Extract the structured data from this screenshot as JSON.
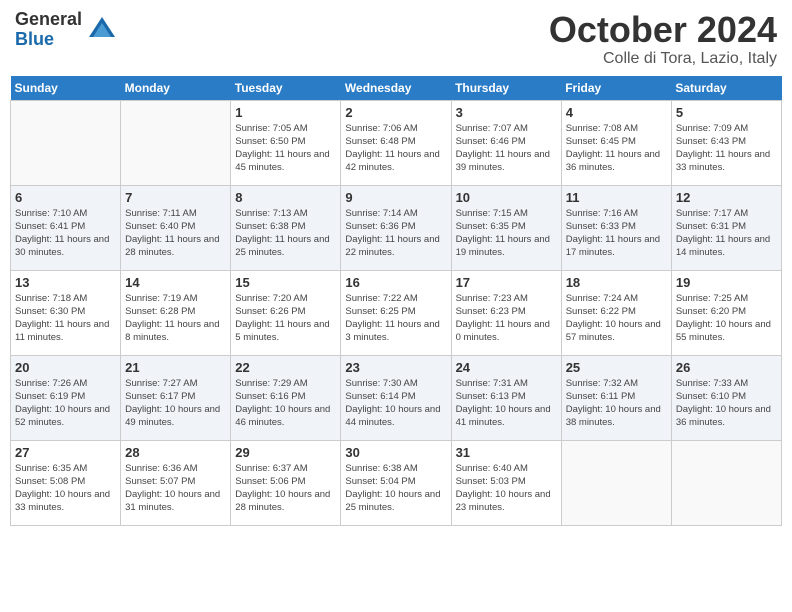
{
  "logo": {
    "general": "General",
    "blue": "Blue"
  },
  "title": "October 2024",
  "location": "Colle di Tora, Lazio, Italy",
  "days_header": [
    "Sunday",
    "Monday",
    "Tuesday",
    "Wednesday",
    "Thursday",
    "Friday",
    "Saturday"
  ],
  "weeks": [
    [
      {
        "num": "",
        "sunrise": "",
        "sunset": "",
        "daylight": ""
      },
      {
        "num": "",
        "sunrise": "",
        "sunset": "",
        "daylight": ""
      },
      {
        "num": "1",
        "sunrise": "Sunrise: 7:05 AM",
        "sunset": "Sunset: 6:50 PM",
        "daylight": "Daylight: 11 hours and 45 minutes."
      },
      {
        "num": "2",
        "sunrise": "Sunrise: 7:06 AM",
        "sunset": "Sunset: 6:48 PM",
        "daylight": "Daylight: 11 hours and 42 minutes."
      },
      {
        "num": "3",
        "sunrise": "Sunrise: 7:07 AM",
        "sunset": "Sunset: 6:46 PM",
        "daylight": "Daylight: 11 hours and 39 minutes."
      },
      {
        "num": "4",
        "sunrise": "Sunrise: 7:08 AM",
        "sunset": "Sunset: 6:45 PM",
        "daylight": "Daylight: 11 hours and 36 minutes."
      },
      {
        "num": "5",
        "sunrise": "Sunrise: 7:09 AM",
        "sunset": "Sunset: 6:43 PM",
        "daylight": "Daylight: 11 hours and 33 minutes."
      }
    ],
    [
      {
        "num": "6",
        "sunrise": "Sunrise: 7:10 AM",
        "sunset": "Sunset: 6:41 PM",
        "daylight": "Daylight: 11 hours and 30 minutes."
      },
      {
        "num": "7",
        "sunrise": "Sunrise: 7:11 AM",
        "sunset": "Sunset: 6:40 PM",
        "daylight": "Daylight: 11 hours and 28 minutes."
      },
      {
        "num": "8",
        "sunrise": "Sunrise: 7:13 AM",
        "sunset": "Sunset: 6:38 PM",
        "daylight": "Daylight: 11 hours and 25 minutes."
      },
      {
        "num": "9",
        "sunrise": "Sunrise: 7:14 AM",
        "sunset": "Sunset: 6:36 PM",
        "daylight": "Daylight: 11 hours and 22 minutes."
      },
      {
        "num": "10",
        "sunrise": "Sunrise: 7:15 AM",
        "sunset": "Sunset: 6:35 PM",
        "daylight": "Daylight: 11 hours and 19 minutes."
      },
      {
        "num": "11",
        "sunrise": "Sunrise: 7:16 AM",
        "sunset": "Sunset: 6:33 PM",
        "daylight": "Daylight: 11 hours and 17 minutes."
      },
      {
        "num": "12",
        "sunrise": "Sunrise: 7:17 AM",
        "sunset": "Sunset: 6:31 PM",
        "daylight": "Daylight: 11 hours and 14 minutes."
      }
    ],
    [
      {
        "num": "13",
        "sunrise": "Sunrise: 7:18 AM",
        "sunset": "Sunset: 6:30 PM",
        "daylight": "Daylight: 11 hours and 11 minutes."
      },
      {
        "num": "14",
        "sunrise": "Sunrise: 7:19 AM",
        "sunset": "Sunset: 6:28 PM",
        "daylight": "Daylight: 11 hours and 8 minutes."
      },
      {
        "num": "15",
        "sunrise": "Sunrise: 7:20 AM",
        "sunset": "Sunset: 6:26 PM",
        "daylight": "Daylight: 11 hours and 5 minutes."
      },
      {
        "num": "16",
        "sunrise": "Sunrise: 7:22 AM",
        "sunset": "Sunset: 6:25 PM",
        "daylight": "Daylight: 11 hours and 3 minutes."
      },
      {
        "num": "17",
        "sunrise": "Sunrise: 7:23 AM",
        "sunset": "Sunset: 6:23 PM",
        "daylight": "Daylight: 11 hours and 0 minutes."
      },
      {
        "num": "18",
        "sunrise": "Sunrise: 7:24 AM",
        "sunset": "Sunset: 6:22 PM",
        "daylight": "Daylight: 10 hours and 57 minutes."
      },
      {
        "num": "19",
        "sunrise": "Sunrise: 7:25 AM",
        "sunset": "Sunset: 6:20 PM",
        "daylight": "Daylight: 10 hours and 55 minutes."
      }
    ],
    [
      {
        "num": "20",
        "sunrise": "Sunrise: 7:26 AM",
        "sunset": "Sunset: 6:19 PM",
        "daylight": "Daylight: 10 hours and 52 minutes."
      },
      {
        "num": "21",
        "sunrise": "Sunrise: 7:27 AM",
        "sunset": "Sunset: 6:17 PM",
        "daylight": "Daylight: 10 hours and 49 minutes."
      },
      {
        "num": "22",
        "sunrise": "Sunrise: 7:29 AM",
        "sunset": "Sunset: 6:16 PM",
        "daylight": "Daylight: 10 hours and 46 minutes."
      },
      {
        "num": "23",
        "sunrise": "Sunrise: 7:30 AM",
        "sunset": "Sunset: 6:14 PM",
        "daylight": "Daylight: 10 hours and 44 minutes."
      },
      {
        "num": "24",
        "sunrise": "Sunrise: 7:31 AM",
        "sunset": "Sunset: 6:13 PM",
        "daylight": "Daylight: 10 hours and 41 minutes."
      },
      {
        "num": "25",
        "sunrise": "Sunrise: 7:32 AM",
        "sunset": "Sunset: 6:11 PM",
        "daylight": "Daylight: 10 hours and 38 minutes."
      },
      {
        "num": "26",
        "sunrise": "Sunrise: 7:33 AM",
        "sunset": "Sunset: 6:10 PM",
        "daylight": "Daylight: 10 hours and 36 minutes."
      }
    ],
    [
      {
        "num": "27",
        "sunrise": "Sunrise: 6:35 AM",
        "sunset": "Sunset: 5:08 PM",
        "daylight": "Daylight: 10 hours and 33 minutes."
      },
      {
        "num": "28",
        "sunrise": "Sunrise: 6:36 AM",
        "sunset": "Sunset: 5:07 PM",
        "daylight": "Daylight: 10 hours and 31 minutes."
      },
      {
        "num": "29",
        "sunrise": "Sunrise: 6:37 AM",
        "sunset": "Sunset: 5:06 PM",
        "daylight": "Daylight: 10 hours and 28 minutes."
      },
      {
        "num": "30",
        "sunrise": "Sunrise: 6:38 AM",
        "sunset": "Sunset: 5:04 PM",
        "daylight": "Daylight: 10 hours and 25 minutes."
      },
      {
        "num": "31",
        "sunrise": "Sunrise: 6:40 AM",
        "sunset": "Sunset: 5:03 PM",
        "daylight": "Daylight: 10 hours and 23 minutes."
      },
      {
        "num": "",
        "sunrise": "",
        "sunset": "",
        "daylight": ""
      },
      {
        "num": "",
        "sunrise": "",
        "sunset": "",
        "daylight": ""
      }
    ]
  ]
}
